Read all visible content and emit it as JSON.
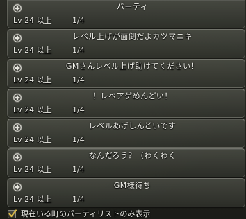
{
  "party_list": {
    "rows": [
      {
        "title": "パーティ",
        "level": "Lv 24 以上",
        "members": "1/4",
        "icon": "party-emblem-icon"
      },
      {
        "title": "レベル上げが面倒だよカツマニキ",
        "level": "Lv 24 以上",
        "members": "1/4",
        "icon": "party-emblem-icon"
      },
      {
        "title": "GMさんレベル上げ助けてください！",
        "level": "Lv 24 以上",
        "members": "1/4",
        "icon": "party-emblem-icon"
      },
      {
        "title": "！レベアゲめんどい！",
        "level": "Lv 24 以上",
        "members": "1/4",
        "icon": "party-emblem-icon"
      },
      {
        "title": "レベルあげしんどいです",
        "level": "Lv 24 以上",
        "members": "1/4",
        "icon": "party-emblem-icon"
      },
      {
        "title": "なんだろう？（わくわく",
        "level": "Lv 24 以上",
        "members": "1/4",
        "icon": "party-emblem-icon"
      },
      {
        "title": "GM様待ち",
        "level": "Lv 24 以上",
        "members": "1/4",
        "icon": "party-emblem-icon"
      }
    ]
  },
  "filter": {
    "label": "現在いる町のパーティリストのみ表示",
    "checked": true,
    "icon": "checkmark-icon"
  },
  "colors": {
    "text": "#f4f4ee",
    "row_background": "#4e5048",
    "check": "#d8b848"
  }
}
